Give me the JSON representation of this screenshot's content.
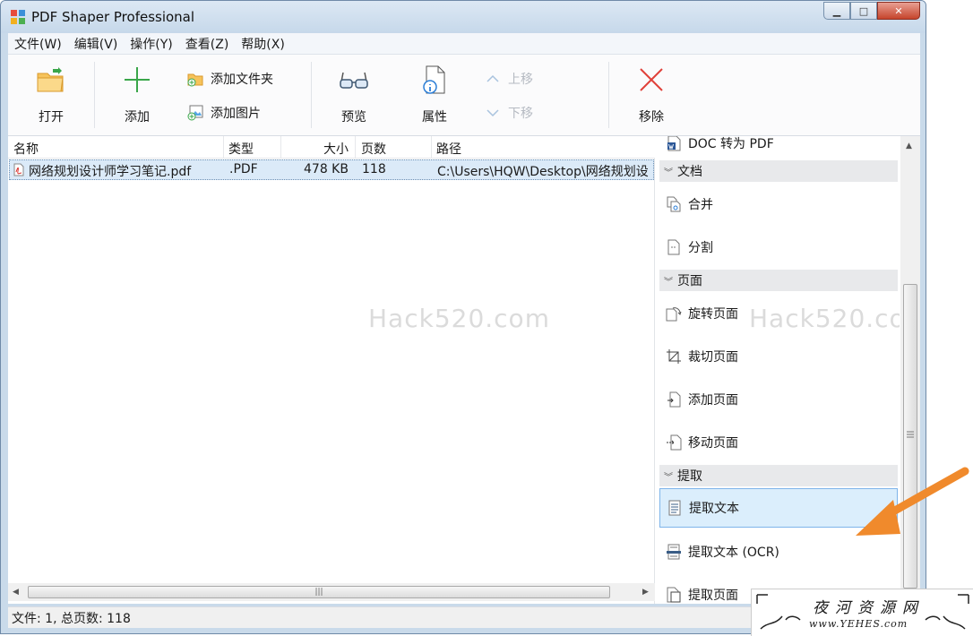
{
  "window": {
    "title": "PDF Shaper Professional",
    "minimize": "▁",
    "maximize": "□",
    "close": "✕"
  },
  "menu": [
    "文件(W)",
    "编辑(V)",
    "操作(Y)",
    "查看(Z)",
    "帮助(X)"
  ],
  "toolbar": {
    "open": "打开",
    "add": "添加",
    "add_folder": "添加文件夹",
    "add_image": "添加图片",
    "preview": "预览",
    "properties": "属性",
    "move_up": "上移",
    "move_down": "下移",
    "remove": "移除"
  },
  "file_list": {
    "columns": [
      "名称",
      "类型",
      "大小",
      "页数",
      "路径"
    ],
    "rows": [
      {
        "name": "网络规划设计师学习笔记.pdf",
        "type": ".PDF",
        "size": "478 KB",
        "pages": "118",
        "path": "C:\\Users\\HQW\\Desktop\\网络规划设"
      }
    ]
  },
  "task_pane": {
    "partial_top": "DOC 转为 PDF",
    "sections": [
      {
        "title": "文档",
        "items": [
          "合并",
          "分割"
        ]
      },
      {
        "title": "页面",
        "items": [
          "旋转页面",
          "裁切页面",
          "添加页面",
          "移动页面"
        ]
      },
      {
        "title": "提取",
        "items": [
          "提取文本",
          "提取文本 (OCR)",
          "提取页面"
        ]
      }
    ]
  },
  "watermark": "Hack520.com",
  "status": "文件: 1, 总页数: 118",
  "stamp": {
    "title": "夜河资源网",
    "url": "www.YEHES.com"
  },
  "colors": {
    "accent_arrow": "#f08a2c",
    "remove_red": "#e0413a",
    "add_green": "#3aa64a",
    "selection": "#dbeaf8"
  }
}
